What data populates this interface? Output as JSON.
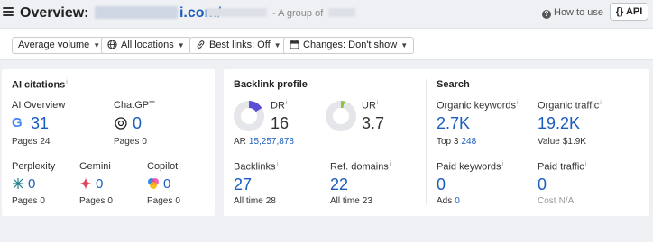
{
  "header": {
    "title_prefix": "Overview:",
    "title_domain_tail": "i.com/",
    "subtitle": "- A group of",
    "how_to_use": "How to use",
    "api_label": "API",
    "api_brace": "{}"
  },
  "filters": [
    {
      "label": "Average volume",
      "icon": "none"
    },
    {
      "label": "All locations",
      "icon": "globe-icon"
    },
    {
      "label": "Best links: Off",
      "icon": "link-icon"
    },
    {
      "label": "Changes: Don't show",
      "icon": "calendar-icon"
    }
  ],
  "ai_citations": {
    "heading": "AI citations",
    "ai_overview": {
      "label": "AI Overview",
      "value": "31",
      "pages_label": "Pages",
      "pages": "24"
    },
    "chatgpt": {
      "label": "ChatGPT",
      "value": "0",
      "pages_label": "Pages",
      "pages": "0"
    },
    "perplexity": {
      "label": "Perplexity",
      "value": "0",
      "pages_label": "Pages",
      "pages": "0"
    },
    "gemini": {
      "label": "Gemini",
      "value": "0",
      "pages_label": "Pages",
      "pages": "0"
    },
    "copilot": {
      "label": "Copilot",
      "value": "0",
      "pages_label": "Pages",
      "pages": "0"
    }
  },
  "backlink_profile": {
    "heading": "Backlink profile",
    "dr": {
      "label": "DR",
      "value": "16",
      "fill_fraction": 0.16,
      "color": "#5b4fd6"
    },
    "ar": {
      "label": "AR",
      "value": "15,257,878"
    },
    "ur": {
      "label": "UR",
      "value": "3.7",
      "fill_fraction": 0.04,
      "color": "#8bc34a"
    },
    "backlinks": {
      "label": "Backlinks",
      "value": "27",
      "sub_label": "All time",
      "sub_value": "28"
    },
    "ref_domains": {
      "label": "Ref. domains",
      "value": "22",
      "sub_label": "All time",
      "sub_value": "23"
    }
  },
  "search": {
    "heading": "Search",
    "organic_keywords": {
      "label": "Organic keywords",
      "value": "2.7K",
      "sub_label": "Top 3",
      "sub_value": "248"
    },
    "organic_traffic": {
      "label": "Organic traffic",
      "value": "19.2K",
      "sub_label": "Value",
      "sub_value": "$1.9K"
    },
    "paid_keywords": {
      "label": "Paid keywords",
      "value": "0",
      "sub_label": "Ads",
      "sub_value": "0"
    },
    "paid_traffic": {
      "label": "Paid traffic",
      "value": "0",
      "sub_label": "Cost",
      "sub_value": "N/A"
    }
  },
  "colors": {
    "link_blue": "#1a5dbf",
    "accent_purple": "#5b4fd6",
    "accent_green": "#8bc34a"
  }
}
